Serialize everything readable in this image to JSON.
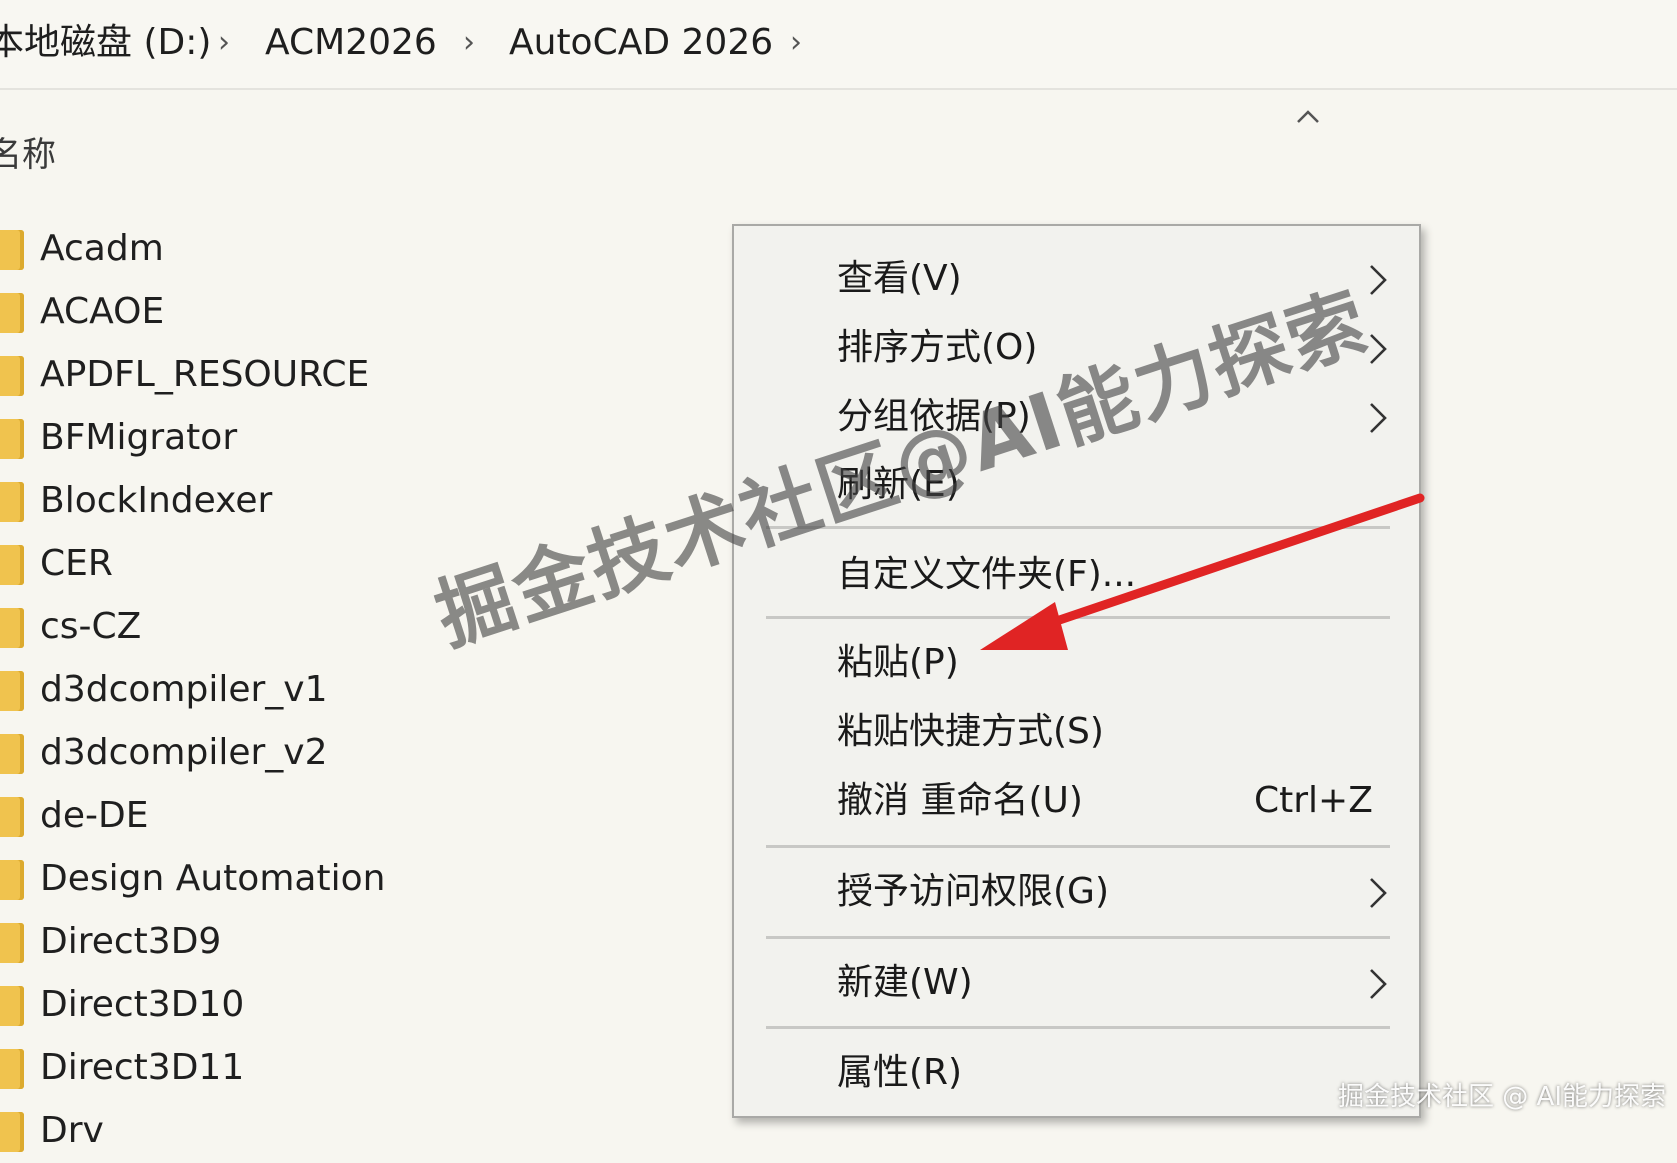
{
  "breadcrumb": {
    "items": [
      "本地磁盘 (D:)",
      "ACM2026",
      "AutoCAD 2026"
    ],
    "separator_icon": "chevron-right-icon"
  },
  "column_header": {
    "name_label": "名称",
    "sort_icon": "chevron-up-icon"
  },
  "file_list": {
    "icon": "folder-icon",
    "folder_color": "#f0c34e",
    "items": [
      "Acadm",
      "ACAOE",
      "APDFL_RESOURCE",
      "BFMigrator",
      "BlockIndexer",
      "CER",
      "cs-CZ",
      "d3dcompiler_v1",
      "d3dcompiler_v2",
      "de-DE",
      "Design Automation",
      "Direct3D9",
      "Direct3D10",
      "Direct3D11",
      "Drv"
    ]
  },
  "context_menu": {
    "items": [
      {
        "label": "查看(V)",
        "submenu": true
      },
      {
        "label": "排序方式(O)",
        "submenu": true
      },
      {
        "label": "分组依据(P)",
        "submenu": true
      },
      {
        "label": "刷新(E)",
        "submenu": false
      },
      {
        "label": "自定义文件夹(F)...",
        "submenu": false
      },
      {
        "label": "粘贴(P)",
        "submenu": false
      },
      {
        "label": "粘贴快捷方式(S)",
        "submenu": false
      },
      {
        "label": "撤消 重命名(U)",
        "submenu": false,
        "shortcut": "Ctrl+Z"
      },
      {
        "label": "授予访问权限(G)",
        "submenu": true
      },
      {
        "label": "新建(W)",
        "submenu": true
      },
      {
        "label": "属性(R)",
        "submenu": false
      }
    ]
  },
  "annotation": {
    "arrow_color": "#e02424",
    "points_to": "粘贴(P)"
  },
  "watermark": {
    "large": "掘金技术社区@AI能力探索",
    "small": "掘金技术社区 @ AI能力探索"
  }
}
